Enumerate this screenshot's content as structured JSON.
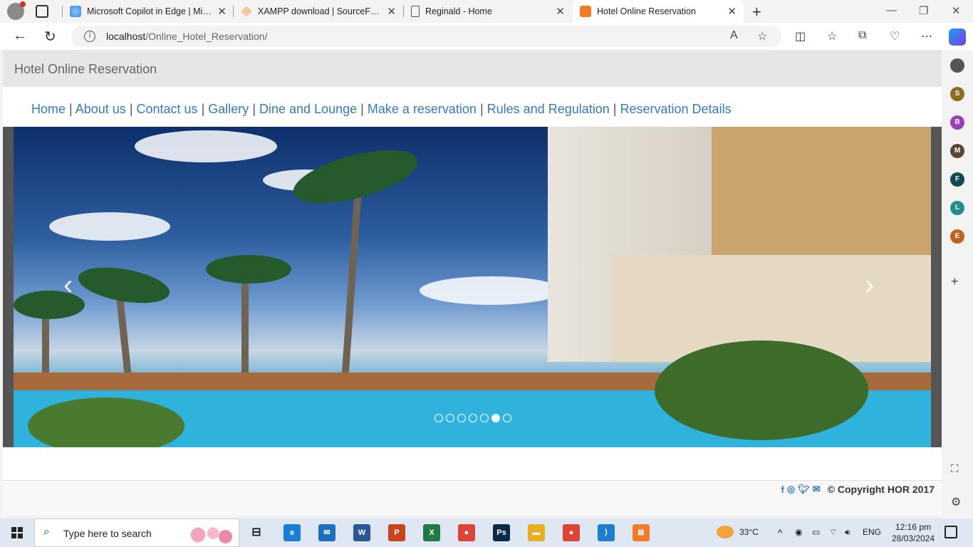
{
  "browser": {
    "tabs": [
      {
        "label": "Microsoft Copilot in Edge | Micro",
        "close": "✕",
        "icon": "copilot-icon"
      },
      {
        "label": "XAMPP download | SourceForge.",
        "close": "✕",
        "icon": "sourceforge-icon"
      },
      {
        "label": "Reginald - Home",
        "close": "✕",
        "icon": "page-icon"
      },
      {
        "label": "Hotel Online Reservation",
        "close": "✕",
        "icon": "xampp-icon"
      }
    ],
    "new_tab": "+",
    "address": {
      "host": "localhost",
      "path": "/Online_Hotel_Reservation/"
    },
    "window_controls": {
      "minimize": "—",
      "restore": "❐",
      "close": "✕"
    }
  },
  "site": {
    "header_title": "Hotel Online Reservation",
    "nav": [
      {
        "label": "Home"
      },
      {
        "label": "About us"
      },
      {
        "label": "Contact us"
      },
      {
        "label": "Gallery"
      },
      {
        "label": "Dine and Lounge"
      },
      {
        "label": "Make a reservation"
      },
      {
        "label": "Rules and Regulation"
      },
      {
        "label": "Reservation Details"
      }
    ],
    "nav_separator": "|",
    "carousel": {
      "prev": "‹",
      "next": "›",
      "slide_count": 7,
      "active_index": 5
    },
    "footer": {
      "copyright": "© Copyright HOR 2017",
      "social_icons": [
        "facebook-icon",
        "instagram-icon",
        "twitter-icon",
        "envelope-icon"
      ]
    }
  },
  "sidebar": {
    "avatars": [
      {
        "letter": "",
        "color": "#555555"
      },
      {
        "letter": "S",
        "color": "#8a6d1f"
      },
      {
        "letter": "B",
        "color": "#9b3fb5"
      },
      {
        "letter": "M",
        "color": "#5a4632"
      },
      {
        "letter": "F",
        "color": "#0d4a52"
      },
      {
        "letter": "L",
        "color": "#1f8f8a"
      },
      {
        "letter": "E",
        "color": "#c0621f"
      }
    ],
    "add": "+"
  },
  "taskbar": {
    "search_placeholder": "Type here to search",
    "apps": [
      {
        "letter": "e",
        "color": "#1a7fd4"
      },
      {
        "letter": "✉",
        "color": "#1a6fc2"
      },
      {
        "letter": "W",
        "color": "#2b5797"
      },
      {
        "letter": "P",
        "color": "#c8441f"
      },
      {
        "letter": "X",
        "color": "#1f7a45"
      },
      {
        "letter": "●",
        "color": "#db4437"
      },
      {
        "letter": "Ps",
        "color": "#0b2a4a"
      },
      {
        "letter": "▬",
        "color": "#e8b020"
      },
      {
        "letter": "●",
        "color": "#db4437"
      },
      {
        "letter": "⟩",
        "color": "#1e7fd1"
      },
      {
        "letter": "⊠",
        "color": "#f07c28"
      }
    ],
    "weather": "33°C",
    "language": "ENG",
    "time": "12:16 pm",
    "date": "28/03/2024"
  }
}
